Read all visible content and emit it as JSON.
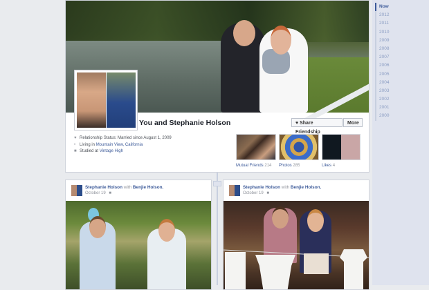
{
  "timeline": {
    "years": [
      "Now",
      "2012",
      "2011",
      "2010",
      "2009",
      "2008",
      "2007",
      "2006",
      "2005",
      "2004",
      "2003",
      "2002",
      "2001",
      "2000"
    ],
    "active": "Now"
  },
  "profile": {
    "title": "You and Stephanie Holson",
    "share_button": "Share Friendship",
    "share_icon": "heart-icon",
    "more_button": "More",
    "about": {
      "relationship": "Relationship Status: Married since August 1, 2009",
      "living_prefix": "Living in ",
      "living_place": "Mountain View, California",
      "studied_prefix": "Studied at ",
      "studied_place": "Vintage High"
    },
    "tiles": {
      "friends_label": "Mutual Friends",
      "friends_count": "214",
      "photos_label": "Photos",
      "photos_count": "285",
      "likes_label": "Likes",
      "likes_count": "4"
    }
  },
  "posts": [
    {
      "author": "Stephanie Holson",
      "with_text": "with",
      "with_name": "Benjie Holson.",
      "date": "October 19",
      "audience_icon": "friends-icon"
    },
    {
      "author": "Stephanie Holson",
      "with_text": "with",
      "with_name": "Benjie Holson.",
      "date": "October 19",
      "audience_icon": "friends-icon"
    }
  ]
}
